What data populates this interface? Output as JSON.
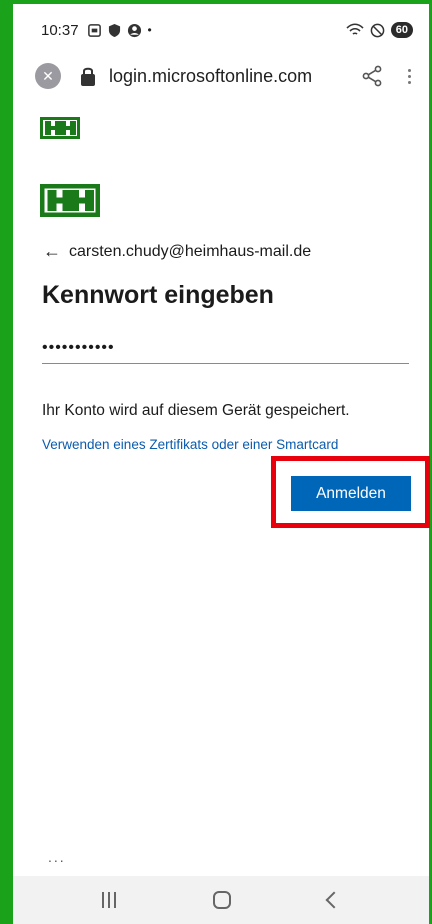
{
  "status_bar": {
    "time": "10:37",
    "battery": "60"
  },
  "browser": {
    "url": "login.microsoftonline.com"
  },
  "login": {
    "logo_text": "HH",
    "account_email": "carsten.chudy@heimhaus-mail.de",
    "title": "Kennwort eingeben",
    "password_value": "•••••••••••",
    "info_text": "Ihr Konto wird auf diesem Gerät gespeichert.",
    "cert_link": "Verwenden eines Zertifikats oder einer Smartcard",
    "signin_button": "Anmelden",
    "footer_dots": "..."
  },
  "colors": {
    "frame": "#1aa31a",
    "logo": "#1a7a1a",
    "primary_button": "#0067b8",
    "highlight": "#e8000c",
    "link": "#0b5cad"
  }
}
